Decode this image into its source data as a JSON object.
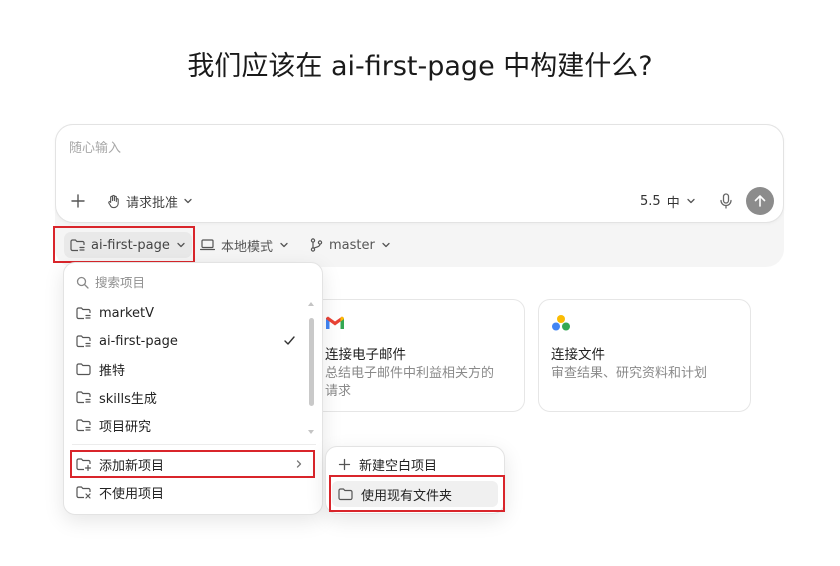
{
  "title": "我们应该在 ai-first-page 中构建什么?",
  "composer": {
    "placeholder": "随心输入",
    "approval_label": "请求批准",
    "model_version": "5.5",
    "model_level": "中"
  },
  "chips": {
    "project": "ai-first-page",
    "mode": "本地模式",
    "branch": "master"
  },
  "cards": [
    {
      "title": "连接电子邮件",
      "desc_line1": "总结电子邮件中利益相关方的",
      "desc_line2": "请求",
      "icon": "gmail-icon"
    },
    {
      "title": "连接文件",
      "desc_line1": "审查结果、研究资料和计划",
      "desc_line2": "",
      "icon": "google-drive-icon"
    }
  ],
  "dropdown": {
    "search_placeholder": "搜索项目",
    "projects": [
      {
        "label": "marketV",
        "icon": "project-folder-icon",
        "selected": false
      },
      {
        "label": "ai-first-page",
        "icon": "project-folder-icon",
        "selected": true
      },
      {
        "label": "推特",
        "icon": "folder-icon",
        "selected": false
      },
      {
        "label": "skills生成",
        "icon": "project-folder-icon",
        "selected": false
      },
      {
        "label": "项目研究",
        "icon": "project-folder-icon",
        "selected": false
      }
    ],
    "add_project": "添加新项目",
    "no_project": "不使用项目"
  },
  "submenu": {
    "new_blank": "新建空白项目",
    "use_existing": "使用现有文件夹"
  },
  "colors": {
    "highlight": "#d9252b",
    "send_button": "#8c8c8c"
  }
}
